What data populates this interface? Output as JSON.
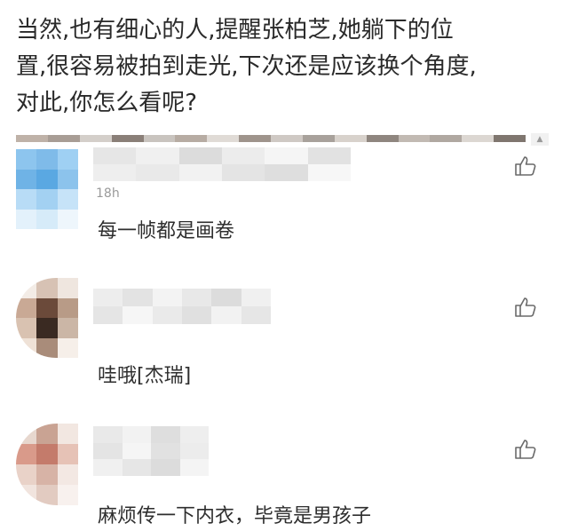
{
  "article": {
    "lines": [
      "当然,也有细心的人,提醒张柏芝,她躺下的位",
      "置,很容易被拍到走光,下次还是应该换个角度,",
      "对此,你怎么看呢?"
    ]
  },
  "banner_colors": [
    "#bfb2a8",
    "#a89d95",
    "#d4cfca",
    "#8a7f78",
    "#c9c4bf",
    "#b7aca3",
    "#e0dbd6",
    "#9f948c",
    "#cfc9c4",
    "#a8a19b",
    "#d8d2cc",
    "#8f867f",
    "#c2bab3",
    "#b0a8a1",
    "#dcd7d2",
    "#7f766f"
  ],
  "comments": [
    {
      "avatar_colors": [
        "#8dc5ee",
        "#7fbbe9",
        "#9fd0f3",
        "#6fb3e6",
        "#5aa8e2",
        "#8cc3ec",
        "#b8dcf6",
        "#a3d1f2",
        "#c6e3f8",
        "#e3f1fb",
        "#d6ebf9",
        "#eef6fc"
      ],
      "name_colors": [
        "#e6e6e6",
        "#f0f0f0",
        "#dcdcdc",
        "#ececec",
        "#f5f5f5",
        "#e2e2e2",
        "#eeeeee",
        "#e9e9e9",
        "#f2f2f2",
        "#e4e4e4",
        "#dedede",
        "#f7f7f7"
      ],
      "time": "18h",
      "text": "每一帧都是画卷",
      "like_icon": "thumbs-up-icon"
    },
    {
      "avatar_colors": [
        "#f3ece6",
        "#d7c2b4",
        "#efe6df",
        "#c9a995",
        "#6b4a3a",
        "#b89b87",
        "#d9c2b1",
        "#3a2a22",
        "#cbb6a6",
        "#efe2d7",
        "#a98c7a",
        "#f6efe9"
      ],
      "name_colors": [
        "#ededed",
        "#e3e3e3",
        "#f3f3f3",
        "#e8e8e8",
        "#dcdcdc",
        "#f0f0f0",
        "#e5e5e5",
        "#f6f6f6",
        "#eaeaea",
        "#e0e0e0",
        "#f2f2f2",
        "#e6e6e6"
      ],
      "text": "哇哦[杰瑞]",
      "like_icon": "thumbs-up-icon"
    },
    {
      "avatar_colors": [
        "#e7d7ce",
        "#c9a393",
        "#f2e7e1",
        "#d99a8a",
        "#c47b6b",
        "#e6c2b6",
        "#e9d2c8",
        "#d7b3a6",
        "#f3e8e3",
        "#f1e4de",
        "#e2cbc1",
        "#f8f1ee"
      ],
      "name_colors": [
        "#e9e9e9",
        "#f2f2f2",
        "#dedede",
        "#eeeeee",
        "#e4e4e4",
        "#f5f5f5",
        "#e1e1e1",
        "#ececec",
        "#f0f0f0",
        "#e6e6e6",
        "#dcdcdc",
        "#f4f4f4"
      ],
      "text": "麻烦传一下内衣，毕竟是男孩子",
      "like_icon": "thumbs-up-icon"
    }
  ],
  "scroll_indicator": "▲"
}
